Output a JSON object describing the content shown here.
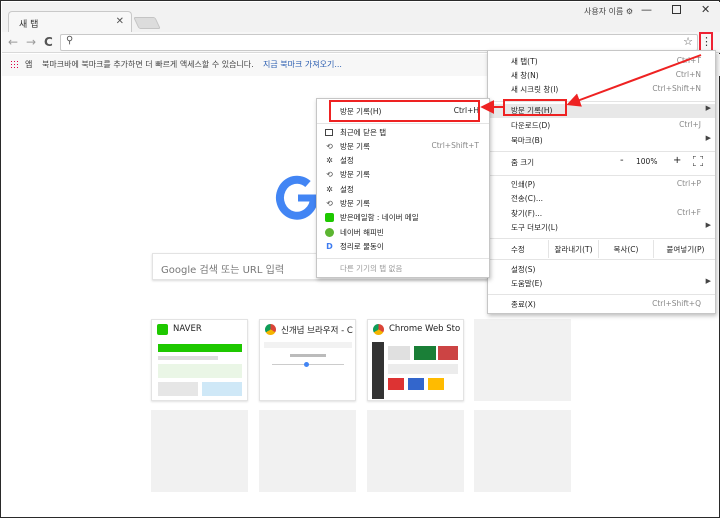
{
  "window": {
    "tab_title": "새 탭",
    "tab_close": "✕",
    "user_name": "사용자 이름 ⚙",
    "min": "—",
    "close": "✕"
  },
  "toolbar": {
    "back": "←",
    "forward": "→",
    "reload": "C",
    "search_glyph": "⚲",
    "star": "☆",
    "menu": "⋮"
  },
  "bookmarks": {
    "apps_label": "앱",
    "message": "북마크바에 북마크를 추가하면 더 빠르게 액세스할 수 있습니다.",
    "import_link": "지금 북마크 가져오기..."
  },
  "ntp": {
    "search_placeholder": "Google 검색 또는 URL 입력",
    "tiles": [
      {
        "title": "NAVER",
        "favicon_color": "#1ec800"
      },
      {
        "title": "신개념 브라우저 - C...",
        "favicon_color": "#db4437"
      },
      {
        "title": "Chrome Web Store",
        "favicon_color": "#4285f4"
      }
    ]
  },
  "menu": {
    "items": [
      {
        "label": "새 탭(T)",
        "shortcut": "Ctrl+T"
      },
      {
        "label": "새 창(N)",
        "shortcut": "Ctrl+N"
      },
      {
        "label": "새 시크릿 창(I)",
        "shortcut": "Ctrl+Shift+N"
      },
      {
        "label": "방문 기록(H)",
        "shortcut": ""
      },
      {
        "label": "다운로드(D)",
        "shortcut": "Ctrl+J"
      },
      {
        "label": "북마크(B)",
        "shortcut": ""
      },
      {
        "label": "인쇄(P)",
        "shortcut": "Ctrl+P"
      },
      {
        "label": "전송(C)...",
        "shortcut": ""
      },
      {
        "label": "찾기(F)...",
        "shortcut": "Ctrl+F"
      },
      {
        "label": "도구 더보기(L)",
        "shortcut": ""
      },
      {
        "label": "설정(S)",
        "shortcut": ""
      },
      {
        "label": "도움말(E)",
        "shortcut": ""
      },
      {
        "label": "종료(X)",
        "shortcut": "Ctrl+Shift+Q"
      }
    ],
    "zoom": {
      "label": "줌 크기",
      "minus": "-",
      "value": "100%",
      "plus": "+"
    },
    "edit": {
      "label": "수정",
      "cut": "잘라내기(T)",
      "copy": "복사(C)",
      "paste": "붙여넣기(P)"
    }
  },
  "history_submenu": {
    "header": {
      "label": "방문 기록(H)",
      "shortcut": "Ctrl+H"
    },
    "items": [
      {
        "label": "최근에 닫은 탭",
        "shortcut": "",
        "icon": "tab-icon"
      },
      {
        "label": "방문 기록",
        "shortcut": "Ctrl+Shift+T",
        "icon": "history-icon"
      },
      {
        "label": "설정",
        "shortcut": "",
        "icon": "gear-icon"
      },
      {
        "label": "방문 기록",
        "shortcut": "",
        "icon": "history-icon"
      },
      {
        "label": "설정",
        "shortcut": "",
        "icon": "gear-icon"
      },
      {
        "label": "방문 기록",
        "shortcut": "",
        "icon": "history-icon"
      },
      {
        "label": "받은메일함 : 네이버 메일",
        "shortcut": "",
        "icon": "naver-mail-icon"
      },
      {
        "label": "네이버 해피빈",
        "shortcut": "",
        "icon": "happybean-icon"
      },
      {
        "label": "정리로 물동이",
        "shortcut": "",
        "icon": "daum-icon"
      }
    ],
    "footer": "다른 기기의 탭 없음"
  },
  "colors": {
    "annotation_red": "#e22222",
    "link_blue": "#2a5db0"
  }
}
